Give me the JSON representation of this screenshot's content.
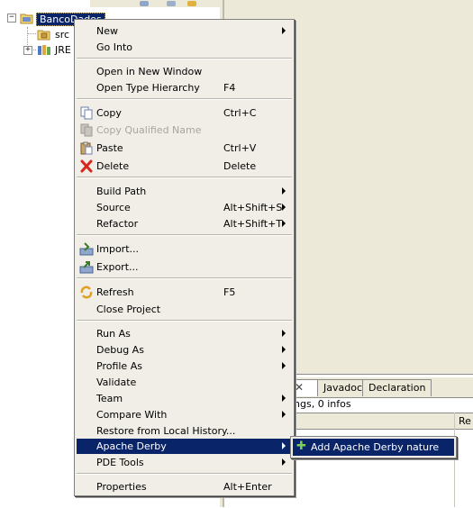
{
  "explorer": {
    "project": "BancoDados",
    "items": [
      {
        "label": "src",
        "icon": "package-folder-icon"
      },
      {
        "label": "JRE",
        "icon": "library-icon"
      }
    ]
  },
  "bottom_panel": {
    "tabs": [
      "Javadoc",
      "Declaration"
    ],
    "status": "nings, 0 infos",
    "column_fragment": "Re"
  },
  "context_menu": {
    "items": [
      {
        "label": "New",
        "submenu": true
      },
      {
        "label": "Go Into"
      },
      {
        "label": "Open in New Window"
      },
      {
        "label": "Open Type Hierarchy",
        "shortcut": "F4"
      },
      {
        "label": "Copy",
        "shortcut": "Ctrl+C",
        "icon": "copy-icon"
      },
      {
        "label": "Copy Qualified Name",
        "disabled": true,
        "icon": "copy-icon"
      },
      {
        "label": "Paste",
        "shortcut": "Ctrl+V",
        "icon": "paste-icon"
      },
      {
        "label": "Delete",
        "shortcut": "Delete",
        "icon": "delete-icon"
      },
      {
        "label": "Build Path",
        "submenu": true
      },
      {
        "label": "Source",
        "shortcut": "Alt+Shift+S",
        "submenu": true
      },
      {
        "label": "Refactor",
        "shortcut": "Alt+Shift+T",
        "submenu": true
      },
      {
        "label": "Import...",
        "icon": "import-icon"
      },
      {
        "label": "Export...",
        "icon": "export-icon"
      },
      {
        "label": "Refresh",
        "shortcut": "F5",
        "icon": "refresh-icon"
      },
      {
        "label": "Close Project"
      },
      {
        "label": "Run As",
        "submenu": true
      },
      {
        "label": "Debug As",
        "submenu": true
      },
      {
        "label": "Profile As",
        "submenu": true
      },
      {
        "label": "Validate"
      },
      {
        "label": "Team",
        "submenu": true
      },
      {
        "label": "Compare With",
        "submenu": true
      },
      {
        "label": "Restore from Local History..."
      },
      {
        "label": "Apache Derby",
        "submenu": true,
        "highlighted": true
      },
      {
        "label": "PDE Tools",
        "submenu": true
      },
      {
        "label": "Properties",
        "shortcut": "Alt+Enter"
      }
    ]
  },
  "submenu": {
    "label": "Add Apache Derby nature",
    "icon": "add-nature-icon"
  },
  "colors": {
    "selection": "#0a246a",
    "menu_bg": "#f0eee6",
    "window_bg": "#ece9d8"
  }
}
